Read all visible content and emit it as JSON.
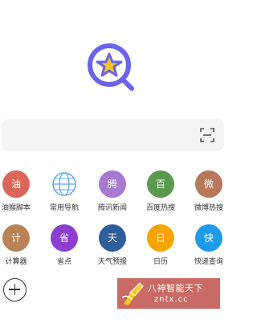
{
  "logo": {
    "icon": "star-search-icon",
    "ring_color": "#6b63e8",
    "star_color": "#f6c624"
  },
  "search": {
    "placeholder": "",
    "scan_icon": "scan-icon"
  },
  "apps": [
    {
      "label": "油猴脚本",
      "glyph": "油",
      "color": "#d9685a"
    },
    {
      "label": "常用导航",
      "glyph": "",
      "color": "#3f8fd6",
      "icon": "globe-icon"
    },
    {
      "label": "腾讯新闻",
      "glyph": "腾",
      "color": "#a77ad3"
    },
    {
      "label": "百度热搜",
      "glyph": "百",
      "color": "#5a9a4e"
    },
    {
      "label": "微博热搜",
      "glyph": "微",
      "color": "#b8785c"
    },
    {
      "label": "计算器",
      "glyph": "计",
      "color": "#b98357"
    },
    {
      "label": "省点",
      "glyph": "省",
      "color": "#8b3fd1"
    },
    {
      "label": "天气预报",
      "glyph": "天",
      "color": "#2f5f9a"
    },
    {
      "label": "日历",
      "glyph": "日",
      "color": "#f5a400"
    },
    {
      "label": "快递查询",
      "glyph": "快",
      "color": "#1e9be8"
    }
  ],
  "add_button": {
    "icon": "plus-icon"
  },
  "watermark": {
    "line1": "八神智能天下",
    "line2": "zntx.cc",
    "color": "#c96a64"
  }
}
